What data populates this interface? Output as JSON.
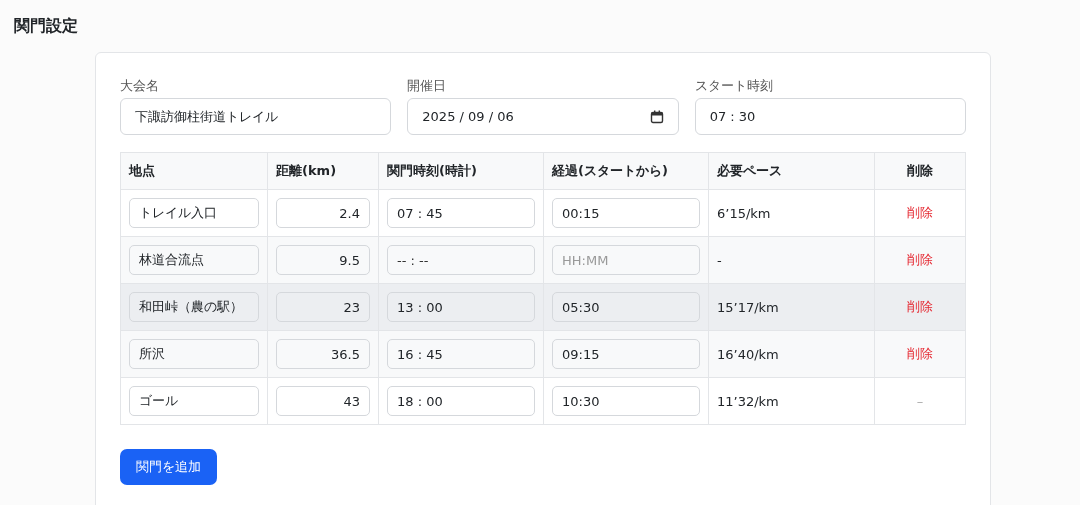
{
  "page_title": "関門設定",
  "fields": [
    {
      "label": "大会名",
      "value": "下諏訪御柱街道トレイル",
      "kind": "text"
    },
    {
      "label": "開催日",
      "value": "2025 / 09 / 06",
      "kind": "date"
    },
    {
      "label": "スタート時刻",
      "value": "07 : 30",
      "kind": "text"
    }
  ],
  "table": {
    "columns": [
      "地点",
      "距離(km)",
      "関門時刻(時計)",
      "経過(スタートから)",
      "必要ペース",
      "削除"
    ],
    "rows": [
      {
        "highlighted": false,
        "point": "トレイル入口",
        "distance": "2.4",
        "cutoff": {
          "value": "07 : 45"
        },
        "elapsed": {
          "value": "00:15"
        },
        "pace": "6’15/km",
        "delete": {
          "label": "削除",
          "disabled": false
        }
      },
      {
        "highlighted": false,
        "point": "林道合流点",
        "distance": "9.5",
        "cutoff": {
          "placeholder": "-- : --"
        },
        "elapsed": {
          "placeholder": "HH:MM"
        },
        "pace": "-",
        "delete": {
          "label": "削除",
          "disabled": false
        }
      },
      {
        "highlighted": true,
        "point": "和田峠（農の駅）",
        "distance": "23",
        "cutoff": {
          "value": "13 : 00"
        },
        "elapsed": {
          "value": "05:30"
        },
        "pace": "15’17/km",
        "delete": {
          "label": "削除",
          "disabled": false
        }
      },
      {
        "highlighted": false,
        "point": "所沢",
        "distance": "36.5",
        "cutoff": {
          "value": "16 : 45"
        },
        "elapsed": {
          "value": "09:15"
        },
        "pace": "16’40/km",
        "delete": {
          "label": "削除",
          "disabled": false
        }
      },
      {
        "highlighted": false,
        "point": "ゴール",
        "distance": "43",
        "cutoff": {
          "value": "18 : 00"
        },
        "elapsed": {
          "value": "10:30"
        },
        "pace": "11’32/km",
        "delete": {
          "label": "–",
          "disabled": true
        }
      }
    ]
  },
  "add_button": "関門を追加"
}
